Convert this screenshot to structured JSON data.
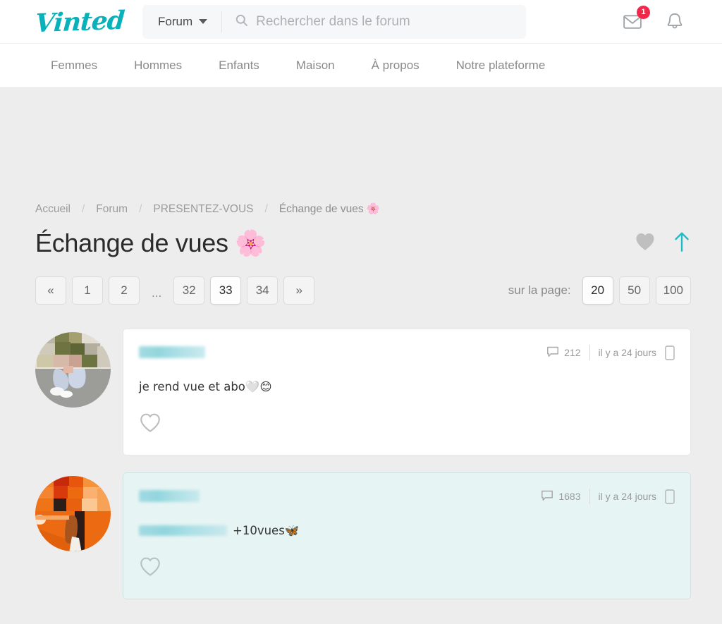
{
  "header": {
    "logo_text": "Vinted",
    "search": {
      "category_label": "Forum",
      "placeholder": "Rechercher dans le forum",
      "value": "",
      "search_icon": "search-icon",
      "caret_icon": "chevron-down-icon"
    },
    "icons": {
      "messages": {
        "name": "envelope-icon",
        "badge": "1"
      },
      "notifications": {
        "name": "bell-icon"
      }
    }
  },
  "nav": {
    "items": [
      {
        "label": "Femmes"
      },
      {
        "label": "Hommes"
      },
      {
        "label": "Enfants"
      },
      {
        "label": "Maison"
      },
      {
        "label": "À propos"
      },
      {
        "label": "Notre plateforme"
      }
    ]
  },
  "breadcrumb": {
    "separator": "/",
    "items": [
      {
        "label": "Accueil"
      },
      {
        "label": "Forum"
      },
      {
        "label": "PRESENTEZ-VOUS"
      },
      {
        "label": "Échange de vues 🌸"
      }
    ]
  },
  "title": {
    "text": "Échange de vues 🌸",
    "favorite_icon": "heart-filled-icon",
    "scroll_top_icon": "arrow-up-icon",
    "accent_color": "#09b1ba",
    "heart_color": "#bfbfbf"
  },
  "pagination": {
    "prev_label": "«",
    "next_label": "»",
    "ellipsis": "...",
    "pages": [
      "1",
      "2"
    ],
    "tail_pages": [
      "32",
      "33",
      "34"
    ],
    "current_page": "33",
    "per_page_label": "sur la page:",
    "per_page_options": [
      "20",
      "50",
      "100"
    ],
    "per_page_selected": "20"
  },
  "posts": [
    {
      "username_redacted": true,
      "avatar": "user-avatar-photo-1",
      "comments_icon": "comment-bubble-icon",
      "comments_count": "212",
      "time": "il y a 24 jours",
      "device_icon": "mobile-device-icon",
      "body_text": "je rend vue et abo🤍😊",
      "body_prefix_redacted": false,
      "like_icon": "heart-outline-icon",
      "highlighted": false
    },
    {
      "username_redacted": true,
      "avatar": "user-avatar-photo-2",
      "comments_icon": "comment-bubble-icon",
      "comments_count": "1683",
      "time": "il y a 24 jours",
      "device_icon": "mobile-device-icon",
      "body_text": "+10vues🦋",
      "body_prefix_redacted": true,
      "like_icon": "heart-outline-icon",
      "highlighted": true
    }
  ]
}
